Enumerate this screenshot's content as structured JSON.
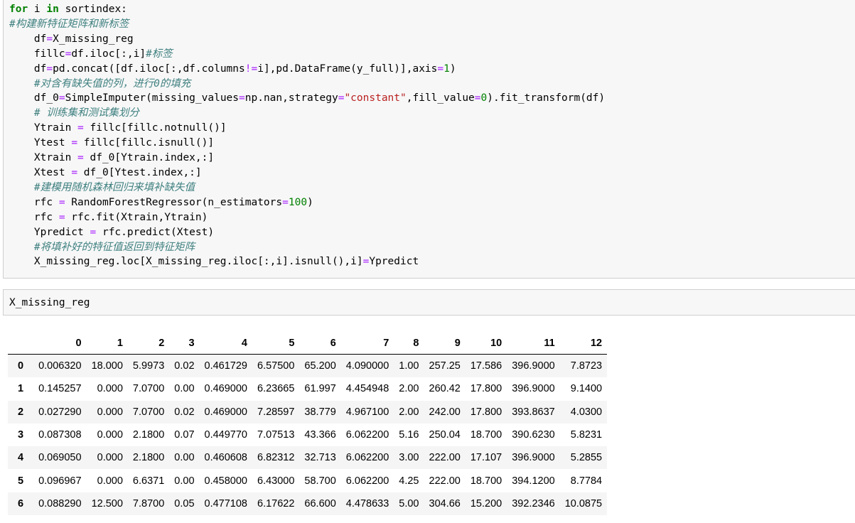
{
  "cell1": {
    "lines": [
      [
        {
          "t": "for",
          "c": "kw"
        },
        {
          "t": " i "
        },
        {
          "t": "in",
          "c": "kw"
        },
        {
          "t": " sortindex:"
        }
      ],
      [
        {
          "t": "#构建新特征矩阵和新标签",
          "c": "cm"
        }
      ],
      [
        {
          "t": "    df"
        },
        {
          "t": "=",
          "c": "op"
        },
        {
          "t": "X_missing_reg"
        }
      ],
      [
        {
          "t": "    fillc"
        },
        {
          "t": "=",
          "c": "op"
        },
        {
          "t": "df.iloc[:,i]"
        },
        {
          "t": "#标签",
          "c": "cm"
        }
      ],
      [
        {
          "t": "    df"
        },
        {
          "t": "=",
          "c": "op"
        },
        {
          "t": "pd.concat([df.iloc[:,df.columns"
        },
        {
          "t": "!=",
          "c": "op"
        },
        {
          "t": "i],pd.DataFrame(y_full)],axis"
        },
        {
          "t": "=",
          "c": "op"
        },
        {
          "t": "1",
          "c": "num"
        },
        {
          "t": ")"
        }
      ],
      [
        {
          "t": "    #对含有缺失值的列，进行0的填充",
          "c": "cm"
        }
      ],
      [
        {
          "t": "    df_0"
        },
        {
          "t": "=",
          "c": "op"
        },
        {
          "t": "SimpleImputer(missing_values"
        },
        {
          "t": "=",
          "c": "op"
        },
        {
          "t": "np.nan,strategy"
        },
        {
          "t": "=",
          "c": "op"
        },
        {
          "t": "\"constant\"",
          "c": "str"
        },
        {
          "t": ",fill_value"
        },
        {
          "t": "=",
          "c": "op"
        },
        {
          "t": "0",
          "c": "num"
        },
        {
          "t": ").fit_transform(df)"
        }
      ],
      [
        {
          "t": "    # 训练集和测试集划分",
          "c": "cm"
        }
      ],
      [
        {
          "t": "    Ytrain "
        },
        {
          "t": "=",
          "c": "op"
        },
        {
          "t": " fillc[fillc.notnull()]"
        }
      ],
      [
        {
          "t": "    Ytest "
        },
        {
          "t": "=",
          "c": "op"
        },
        {
          "t": " fillc[fillc.isnull()]"
        }
      ],
      [
        {
          "t": "    Xtrain "
        },
        {
          "t": "=",
          "c": "op"
        },
        {
          "t": " df_0[Ytrain.index,:]"
        }
      ],
      [
        {
          "t": "    Xtest "
        },
        {
          "t": "=",
          "c": "op"
        },
        {
          "t": " df_0[Ytest.index,:]"
        }
      ],
      [
        {
          "t": "    #建模用随机森林回归来填补缺失值",
          "c": "cm"
        }
      ],
      [
        {
          "t": "    rfc "
        },
        {
          "t": "=",
          "c": "op"
        },
        {
          "t": " RandomForestRegressor(n_estimators"
        },
        {
          "t": "=",
          "c": "op"
        },
        {
          "t": "100",
          "c": "num"
        },
        {
          "t": ")"
        }
      ],
      [
        {
          "t": "    rfc "
        },
        {
          "t": "=",
          "c": "op"
        },
        {
          "t": " rfc.fit(Xtrain,Ytrain)"
        }
      ],
      [
        {
          "t": "    Ypredict "
        },
        {
          "t": "=",
          "c": "op"
        },
        {
          "t": " rfc.predict(Xtest)"
        }
      ],
      [
        {
          "t": "    #将填补好的特征值返回到特征矩阵",
          "c": "cm"
        }
      ],
      [
        {
          "t": "    X_missing_reg.loc[X_missing_reg.iloc[:,i].isnull(),i]"
        },
        {
          "t": "=",
          "c": "op"
        },
        {
          "t": "Ypredict"
        }
      ]
    ]
  },
  "cell2": {
    "lines": [
      [
        {
          "t": "X_missing_reg"
        }
      ]
    ]
  },
  "dataframe": {
    "columns": [
      "",
      "0",
      "1",
      "2",
      "3",
      "4",
      "5",
      "6",
      "7",
      "8",
      "9",
      "10",
      "11",
      "12"
    ],
    "index": [
      "0",
      "1",
      "2",
      "3",
      "4",
      "5",
      "6"
    ],
    "rows": [
      [
        "0.006320",
        "18.000",
        "5.9973",
        "0.02",
        "0.461729",
        "6.57500",
        "65.200",
        "4.090000",
        "1.00",
        "257.25",
        "17.586",
        "396.9000",
        "7.8723"
      ],
      [
        "0.145257",
        "0.000",
        "7.0700",
        "0.00",
        "0.469000",
        "6.23665",
        "61.997",
        "4.454948",
        "2.00",
        "260.42",
        "17.800",
        "396.9000",
        "9.1400"
      ],
      [
        "0.027290",
        "0.000",
        "7.0700",
        "0.02",
        "0.469000",
        "7.28597",
        "38.779",
        "4.967100",
        "2.00",
        "242.00",
        "17.800",
        "393.8637",
        "4.0300"
      ],
      [
        "0.087308",
        "0.000",
        "2.1800",
        "0.07",
        "0.449770",
        "7.07513",
        "43.366",
        "6.062200",
        "5.16",
        "250.04",
        "18.700",
        "390.6230",
        "5.8231"
      ],
      [
        "0.069050",
        "0.000",
        "2.1800",
        "0.00",
        "0.460608",
        "6.82312",
        "32.713",
        "6.062200",
        "3.00",
        "222.00",
        "17.107",
        "396.9000",
        "5.2855"
      ],
      [
        "0.096967",
        "0.000",
        "6.6371",
        "0.00",
        "0.458000",
        "6.43000",
        "58.700",
        "6.062200",
        "4.25",
        "222.00",
        "18.700",
        "394.1200",
        "8.7784"
      ],
      [
        "0.088290",
        "12.500",
        "7.8700",
        "0.05",
        "0.477108",
        "6.17622",
        "66.600",
        "4.478633",
        "5.00",
        "304.66",
        "15.200",
        "392.2346",
        "10.0875"
      ]
    ]
  }
}
